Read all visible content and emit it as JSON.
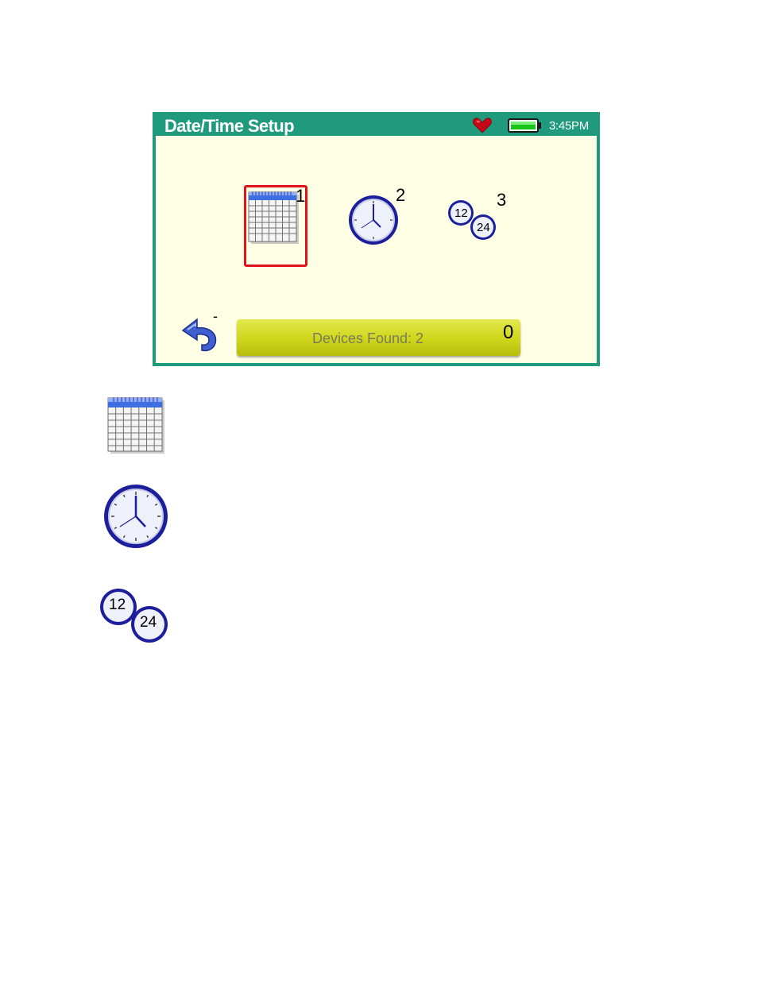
{
  "titlebar": {
    "title": "Date/Time Setup",
    "time": "3:45PM",
    "status_icons": [
      "heart-icon",
      "battery-icon"
    ]
  },
  "options": [
    {
      "number": "1",
      "icon": "calendar-icon",
      "selected": true
    },
    {
      "number": "2",
      "icon": "clock-icon",
      "selected": false
    },
    {
      "number": "3",
      "icon": "12-24-hour-format-icon",
      "selected": false
    }
  ],
  "clock_format_labels": {
    "twelve": "12",
    "twentyfour": "24"
  },
  "footer": {
    "back_icon": "back-arrow-icon",
    "back_hint": "-",
    "devices_label": "Devices Found: 2",
    "devices_count": "0"
  },
  "colors": {
    "titlebar": "#1f9a7c",
    "screen_bg": "#ffffe6",
    "selection": "#e0121a",
    "devices_bar": "#cfd61a",
    "icon_blue": "#1c1f9c"
  }
}
